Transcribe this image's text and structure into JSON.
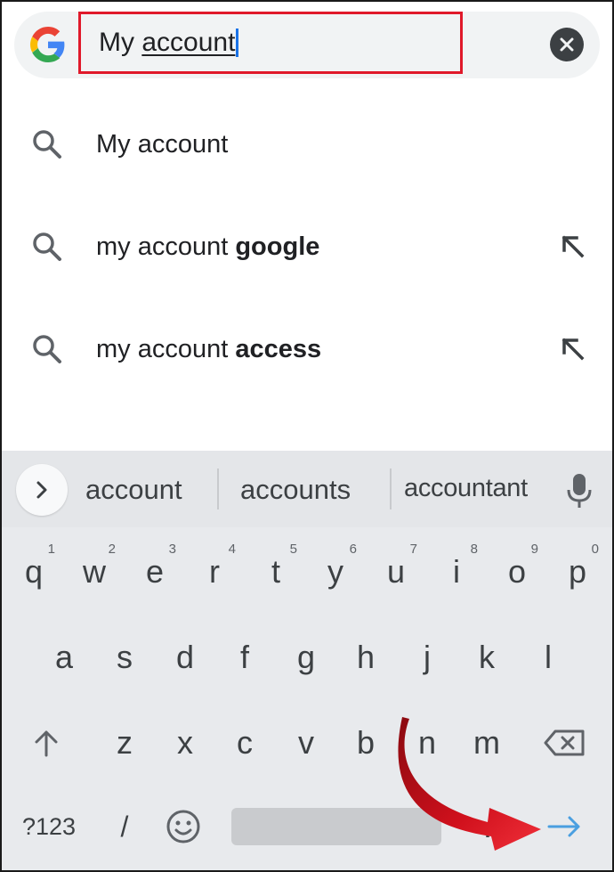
{
  "search": {
    "query_plain": "My ",
    "query_underlined": "account"
  },
  "suggestions": [
    {
      "prefix": "My account",
      "bold": ""
    },
    {
      "prefix": "my account ",
      "bold": "google"
    },
    {
      "prefix": "my account ",
      "bold": "access"
    }
  ],
  "keyboard": {
    "word_suggestions": [
      "account",
      "accounts",
      "accountant"
    ],
    "row1": [
      {
        "key": "q",
        "hint": "1"
      },
      {
        "key": "w",
        "hint": "2"
      },
      {
        "key": "e",
        "hint": "3"
      },
      {
        "key": "r",
        "hint": "4"
      },
      {
        "key": "t",
        "hint": "5"
      },
      {
        "key": "y",
        "hint": "6"
      },
      {
        "key": "u",
        "hint": "7"
      },
      {
        "key": "i",
        "hint": "8"
      },
      {
        "key": "o",
        "hint": "9"
      },
      {
        "key": "p",
        "hint": "0"
      }
    ],
    "row2": [
      "a",
      "s",
      "d",
      "f",
      "g",
      "h",
      "j",
      "k",
      "l"
    ],
    "row3": [
      "z",
      "x",
      "c",
      "v",
      "b",
      "n",
      "m"
    ],
    "symbols_label": "?123",
    "slash_label": "/",
    "period_label": ".",
    "colors": {
      "enter_arrow": "#4a9fe0",
      "highlight_box": "#e0192a",
      "annotation_arrow": "#d0101c"
    }
  }
}
